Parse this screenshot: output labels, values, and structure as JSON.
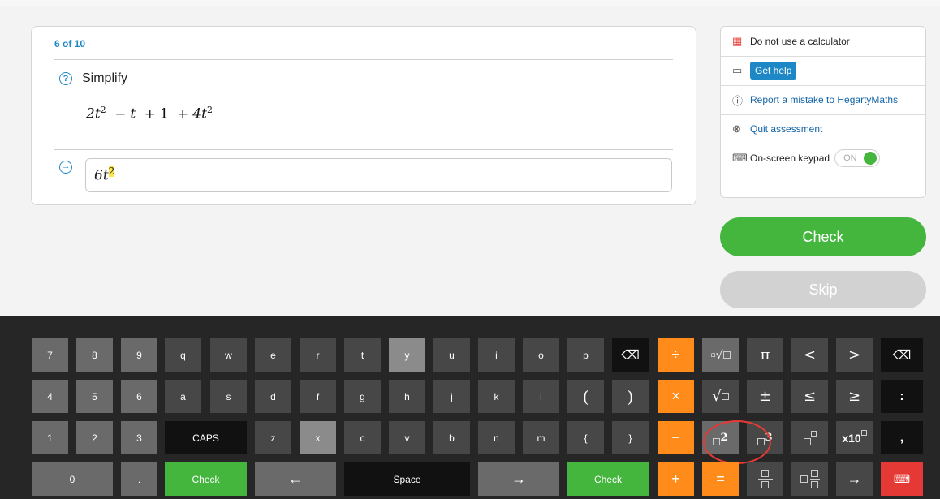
{
  "question": {
    "progress": "6 of 10",
    "instruction": "Simplify",
    "expression": {
      "parts": [
        "2t",
        "2",
        "−",
        "t",
        "+",
        "1",
        "+",
        "4t",
        "2"
      ]
    },
    "answer": {
      "base": "6t",
      "exp": "2"
    }
  },
  "side_panel": {
    "calculator_notice": "Do not use a calculator",
    "get_help": "Get help",
    "report": "Report a mistake to HegartyMaths",
    "quit": "Quit assessment",
    "keypad_label": "On-screen keypad",
    "keypad_toggle": "ON"
  },
  "buttons": {
    "check": "Check",
    "skip": "Skip"
  },
  "keypad": {
    "row1": [
      "7",
      "8",
      "9",
      "q",
      "w",
      "e",
      "r",
      "t",
      "y",
      "u",
      "i",
      "o",
      "p",
      "⌫",
      "÷",
      "",
      "π",
      "<",
      ">",
      "⌫"
    ],
    "row2": [
      "4",
      "5",
      "6",
      "a",
      "s",
      "d",
      "f",
      "g",
      "h",
      "j",
      "k",
      "l",
      "(",
      ")",
      "×",
      "√",
      "±",
      "≤",
      "≥",
      ":"
    ],
    "row3": [
      "1",
      "2",
      "3",
      "CAPS",
      "z",
      "x",
      "c",
      "v",
      "b",
      "n",
      "m",
      "{",
      "}",
      "−",
      "2",
      "3",
      "",
      "x10",
      ","
    ],
    "row4": [
      "0",
      ".",
      "Check",
      "←",
      "Space",
      "→",
      "Check",
      "+",
      "=",
      "→"
    ]
  }
}
